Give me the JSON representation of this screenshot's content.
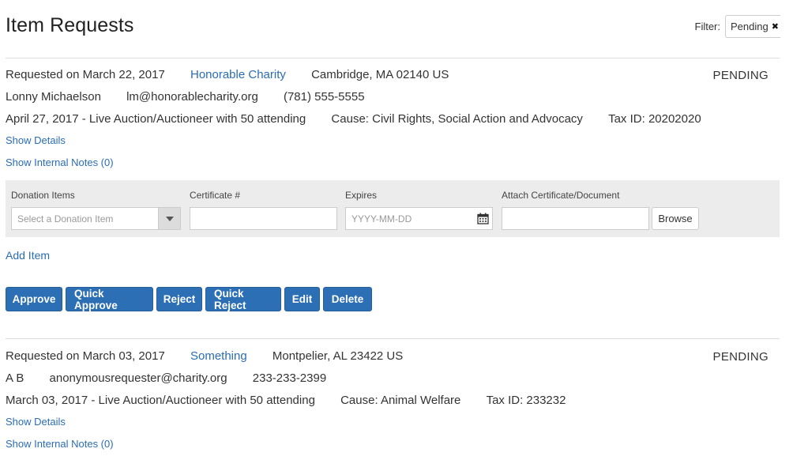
{
  "page": {
    "title": "Item Requests"
  },
  "filter": {
    "label": "Filter:",
    "value": "Pending",
    "clear_glyph": "✖"
  },
  "requests": [
    {
      "requested_on": "Requested on March 22, 2017",
      "organization": "Honorable Charity",
      "location": "Cambridge, MA 02140 US",
      "status": "PENDING",
      "contact_name": "Lonny Michaelson",
      "contact_email": "lm@honorablecharity.org",
      "contact_phone": "(781) 555-5555",
      "event": "April 27, 2017 - Live Auction/Auctioneer with 50 attending",
      "cause": "Cause: Civil Rights, Social Action and Advocacy",
      "tax_id": "Tax ID: 20202020",
      "show_details": "Show Details",
      "show_notes": "Show Internal Notes (0)"
    },
    {
      "requested_on": "Requested on March 03, 2017",
      "organization": "Something",
      "location": "Montpelier, AL 23422 US",
      "status": "PENDING",
      "contact_name": "A B",
      "contact_email": "anonymousrequester@charity.org",
      "contact_phone": "233-233-2399",
      "event": "March 03, 2017 - Live Auction/Auctioneer with 50 attending",
      "cause": "Cause: Animal Welfare",
      "tax_id": "Tax ID: 233232",
      "show_details": "Show Details",
      "show_notes": "Show Internal Notes (0)"
    }
  ],
  "donation_form": {
    "col_items": "Donation Items",
    "col_certificate": "Certificate #",
    "col_expires": "Expires",
    "col_attach": "Attach Certificate/Document",
    "item_placeholder": "Select a Donation Item",
    "certificate_value": "",
    "expires_placeholder": "YYYY-MM-DD",
    "attach_value": "",
    "browse_label": "Browse",
    "add_item": "Add Item",
    "icons": {
      "select": "chevron-down-icon",
      "calendar": "calendar-icon"
    }
  },
  "actions": {
    "approve": "Approve",
    "quick_approve": "Quick Approve",
    "reject": "Reject",
    "quick_reject": "Quick Reject",
    "edit": "Edit",
    "delete": "Delete"
  },
  "colors": {
    "link": "#2a6db5",
    "button": "#2c6fb5",
    "panel": "#ececec",
    "divider": "#dddddd"
  }
}
